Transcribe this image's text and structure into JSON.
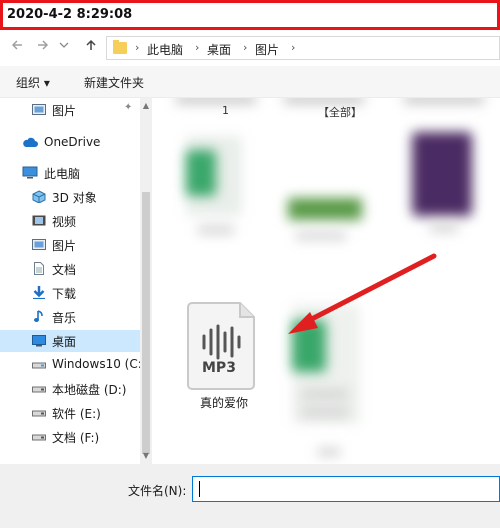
{
  "window": {
    "title": "2020-4-2 8:29:08"
  },
  "nav": {
    "back_icon": "arrow-left-icon",
    "forward_icon": "arrow-right-icon",
    "recent_icon": "chevron-down-icon",
    "up_icon": "arrow-up-icon",
    "breadcrumbs": [
      "此电脑",
      "桌面",
      "图片"
    ]
  },
  "toolbar": {
    "organize": "组织 ▾",
    "new_folder": "新建文件夹"
  },
  "sidebar": {
    "items": [
      {
        "label": "图片",
        "icon": "pictures-icon",
        "pinned": true
      },
      {
        "label": "OneDrive",
        "icon": "cloud-icon"
      },
      {
        "label": "此电脑",
        "icon": "computer-icon"
      },
      {
        "label": "3D 对象",
        "icon": "cube-icon"
      },
      {
        "label": "视频",
        "icon": "video-icon"
      },
      {
        "label": "图片",
        "icon": "pictures-icon"
      },
      {
        "label": "文档",
        "icon": "document-icon"
      },
      {
        "label": "下载",
        "icon": "download-icon"
      },
      {
        "label": "音乐",
        "icon": "music-icon"
      },
      {
        "label": "桌面",
        "icon": "desktop-icon",
        "selected": true
      },
      {
        "label": "Windows10 (C:",
        "icon": "drive-icon"
      },
      {
        "label": "本地磁盘 (D:)",
        "icon": "drive-icon"
      },
      {
        "label": "软件 (E:)",
        "icon": "drive-icon"
      },
      {
        "label": "文档 (F:)",
        "icon": "drive-icon"
      }
    ]
  },
  "content": {
    "top_fragments": [
      "1",
      "【全部】"
    ],
    "mp3_file": {
      "name": "真的爱你",
      "badge": "MP3"
    }
  },
  "footer": {
    "filename_label": "文件名(N):",
    "filename_value": ""
  },
  "colors": {
    "highlight_border": "#e8141a",
    "selected_bg": "#cce8ff",
    "arrow": "#e02020",
    "accent": "#0078d7"
  }
}
